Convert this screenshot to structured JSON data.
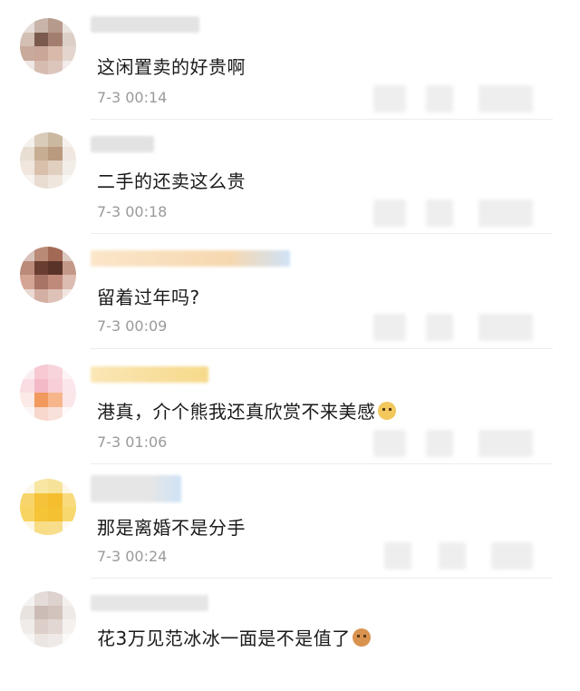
{
  "comments": [
    {
      "text": "这闲置卖的好贵啊",
      "time": "7-3 00:14",
      "emoji": ""
    },
    {
      "text": "二手的还卖这么贵",
      "time": "7-3 00:18",
      "emoji": ""
    },
    {
      "text": "留着过年吗?",
      "time": "7-3 00:09",
      "emoji": ""
    },
    {
      "text": "港真，介个熊我还真欣赏不来美感",
      "time": "7-3 01:06",
      "emoji": "cat-emoji"
    },
    {
      "text": "那是离婚不是分手",
      "time": "7-3 00:24",
      "emoji": ""
    },
    {
      "text": "花3万见范冰冰一面是不是值了",
      "time": "",
      "emoji": "cat-face-emoji"
    }
  ]
}
